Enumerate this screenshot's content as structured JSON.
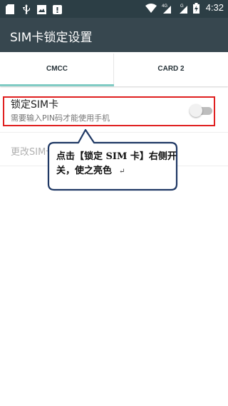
{
  "status_bar": {
    "time": "4:32",
    "net_type_1": "4G",
    "net_type_2": "G",
    "icons": [
      "sd-card-icon",
      "usb-icon",
      "image-icon",
      "notification-icon",
      "wifi-icon",
      "signal-icon",
      "battery-icon"
    ]
  },
  "app_bar": {
    "title": "SIM卡锁定设置"
  },
  "tabs": [
    {
      "label": "CMCC",
      "selected": true
    },
    {
      "label": "CARD 2",
      "selected": false
    }
  ],
  "settings": {
    "lock_sim": {
      "title": "锁定SIM卡",
      "subtitle": "需要输入PIN码才能使用手机",
      "enabled": false
    },
    "change_pin": {
      "title": "更改SIM卡PIN码"
    }
  },
  "annotation": {
    "text": "点击【锁定 SIM 卡】右侧开关，使之亮色",
    "return_mark": "↵",
    "highlight_color": "#e02020",
    "callout_border_color": "#1f3864"
  },
  "colors": {
    "status_bar": "#2c3e45",
    "app_bar": "#37474f",
    "tab_indicator": "#80cbc4"
  }
}
